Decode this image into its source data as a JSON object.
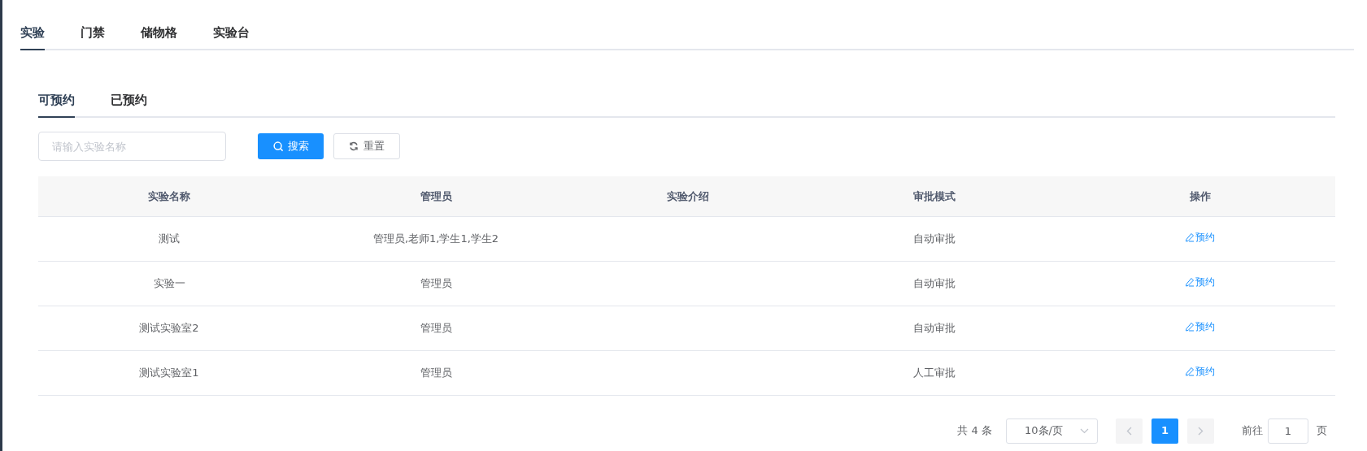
{
  "tabs": [
    {
      "label": "实验",
      "selected": true
    },
    {
      "label": "门禁",
      "selected": false
    },
    {
      "label": "储物格",
      "selected": false
    },
    {
      "label": "实验台",
      "selected": false
    }
  ],
  "sub_tabs": [
    {
      "label": "可预约",
      "selected": true
    },
    {
      "label": "已预约",
      "selected": false
    }
  ],
  "search": {
    "placeholder": "请输入实验名称"
  },
  "buttons": {
    "search": "搜索",
    "reset": "重置"
  },
  "table": {
    "columns": [
      "实验名称",
      "管理员",
      "实验介绍",
      "审批模式",
      "操作"
    ],
    "rows": [
      {
        "name": "测试",
        "admins": "管理员,老师1,学生1,学生2",
        "intro": "",
        "approval": "自动审批",
        "action": "预约"
      },
      {
        "name": "实验一",
        "admins": "管理员",
        "approval": "自动审批",
        "action": "预约"
      },
      {
        "name": "测试实验室2",
        "admins": "管理员",
        "approval": "自动审批",
        "action": "预约"
      },
      {
        "name": "测试实验室1",
        "admins": "管理员",
        "approval": "人工审批",
        "action": "预约"
      }
    ]
  },
  "pagination": {
    "total": "共 4 条",
    "page_size": "10条/页",
    "pages": [
      {
        "label": "1",
        "selected": true
      }
    ],
    "goto_label": "前往",
    "goto_value": "1",
    "goto_suffix": "页"
  }
}
